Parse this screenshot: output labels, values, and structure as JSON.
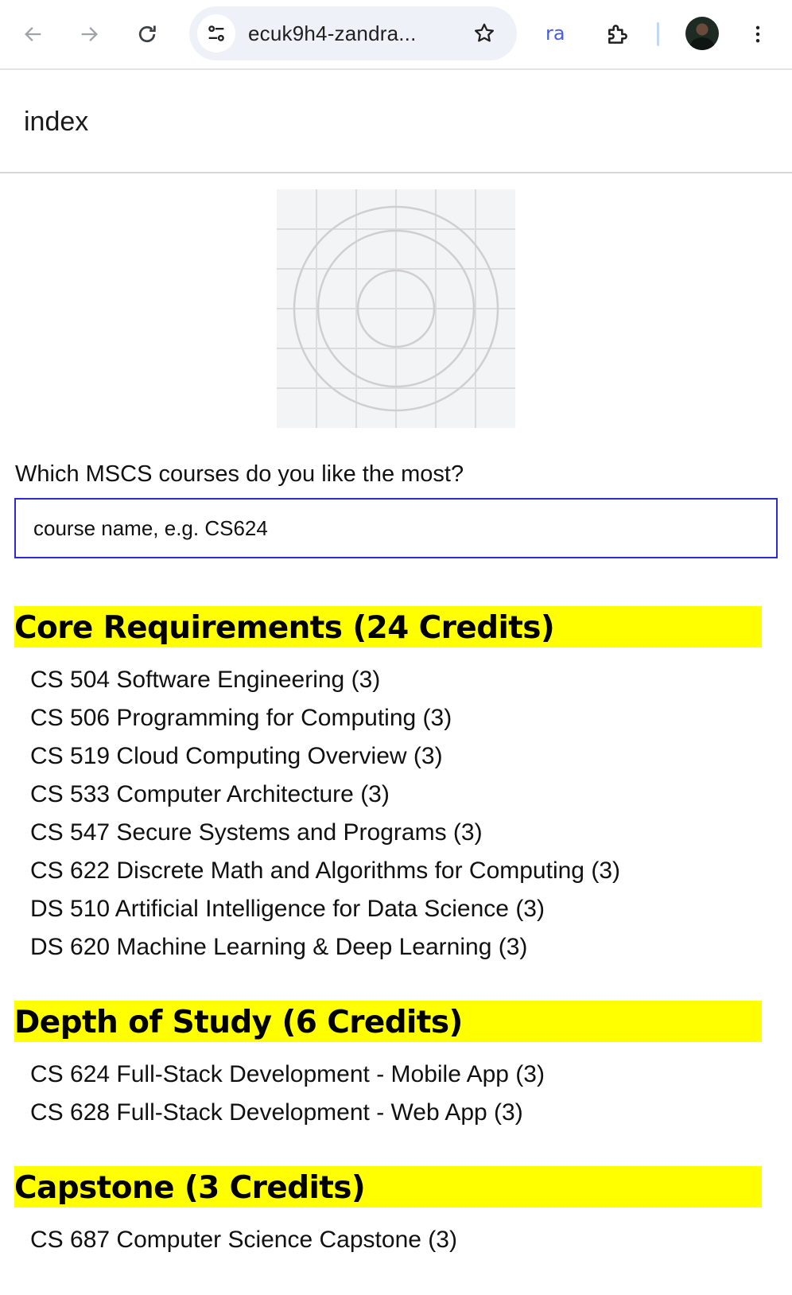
{
  "browser": {
    "url": "ecuk9h4-zandra...",
    "extension_label": "ra"
  },
  "page": {
    "title": "index"
  },
  "form": {
    "question": "Which MSCS courses do you like the most?",
    "placeholder": "course name, e.g. CS624"
  },
  "sections": [
    {
      "title": "Core Requirements (24 Credits)",
      "courses": [
        "CS 504 Software Engineering (3)",
        "CS 506 Programming for Computing (3)",
        "CS 519 Cloud Computing Overview (3)",
        "CS 533 Computer Architecture (3)",
        "CS 547 Secure Systems and Programs (3)",
        "CS 622 Discrete Math and Algorithms for Computing (3)",
        "DS 510 Artificial Intelligence for Data Science (3)",
        "DS 620 Machine Learning & Deep Learning (3)"
      ]
    },
    {
      "title": "Depth of Study (6 Credits)",
      "courses": [
        "CS 624 Full-Stack Development - Mobile App (3)",
        "CS 628 Full-Stack Development - Web App (3)"
      ]
    },
    {
      "title": "Capstone (3 Credits)",
      "courses": [
        "CS 687 Computer Science Capstone (3)"
      ]
    }
  ],
  "colors": {
    "section_highlight": "#ffff00",
    "input_border": "#2d2bd6"
  }
}
